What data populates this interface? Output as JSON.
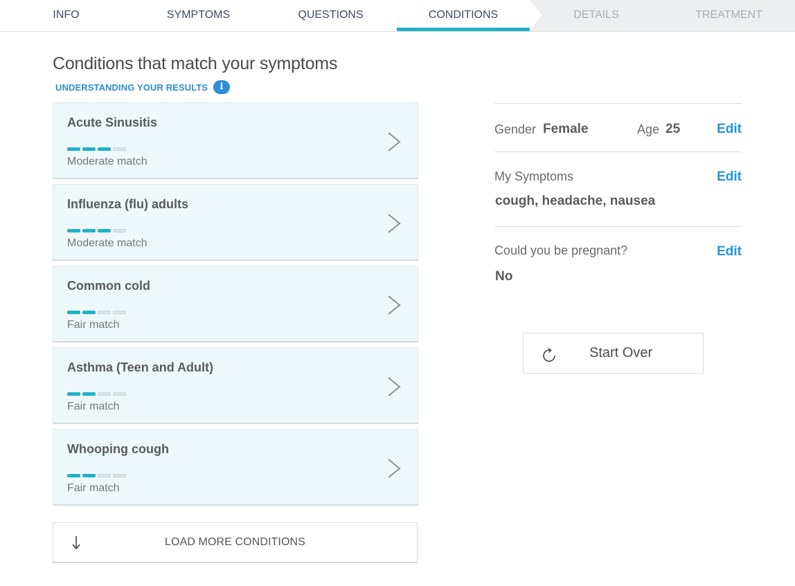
{
  "tabs": [
    {
      "label": "INFO",
      "state": "done"
    },
    {
      "label": "SYMPTOMS",
      "state": "done"
    },
    {
      "label": "QUESTIONS",
      "state": "done"
    },
    {
      "label": "CONDITIONS",
      "state": "active"
    },
    {
      "label": "DETAILS",
      "state": "future"
    },
    {
      "label": "TREATMENT",
      "state": "future"
    }
  ],
  "main": {
    "title": "Conditions that match your symptoms",
    "understanding_link": "UNDERSTANDING YOUR RESULTS",
    "info_glyph": "i",
    "conditions": [
      {
        "name": "Acute Sinusitis",
        "match": "Moderate match",
        "strength": 3,
        "of": 4
      },
      {
        "name": "Influenza (flu) adults",
        "match": "Moderate match",
        "strength": 3,
        "of": 4
      },
      {
        "name": "Common cold",
        "match": "Fair match",
        "strength": 2,
        "of": 4
      },
      {
        "name": "Asthma (Teen and Adult)",
        "match": "Fair match",
        "strength": 2,
        "of": 4
      },
      {
        "name": "Whooping cough",
        "match": "Fair match",
        "strength": 2,
        "of": 4
      }
    ],
    "load_more_label": "LOAD MORE CONDITIONS"
  },
  "summary": {
    "gender_label": "Gender",
    "gender_value": "Female",
    "age_label": "Age",
    "age_value": "25",
    "symptoms_label": "My Symptoms",
    "symptoms_value": "cough, headache, nausea",
    "pregnant_label": "Could you be pregnant?",
    "pregnant_value": "No",
    "edit_label": "Edit",
    "start_over_label": "Start Over"
  },
  "colors": {
    "accent": "#21b1c4",
    "link": "#1e95df",
    "card_bg": "#eef8fa"
  }
}
